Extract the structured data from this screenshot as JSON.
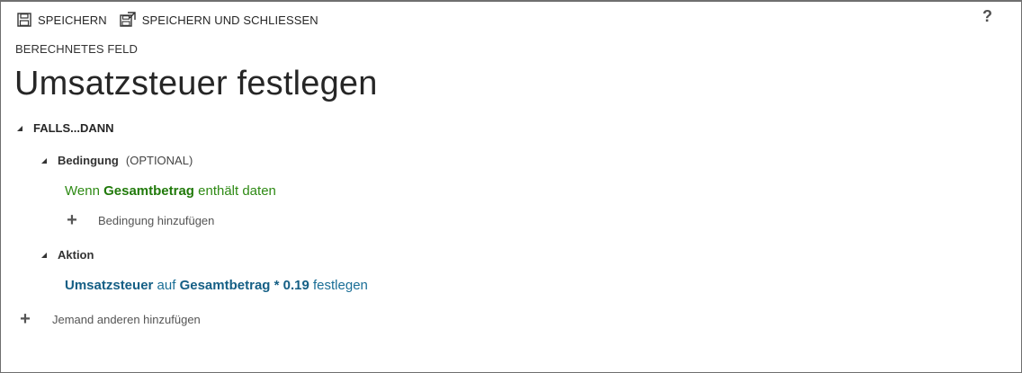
{
  "toolbar": {
    "save_label": "SPEICHERN",
    "save_close_label": "SPEICHERN UND SCHLIESSEN",
    "help_label": "?"
  },
  "header": {
    "eyebrow": "BERECHNETES FELD",
    "title": "Umsatzsteuer festlegen"
  },
  "rule": {
    "section_label": "FALLS...DANN",
    "condition": {
      "label": "Bedingung",
      "optional_label": "(OPTIONAL)",
      "prefix": "Wenn",
      "field": "Gesamtbetrag",
      "operator": "enthält daten",
      "add_label": "Bedingung hinzufügen"
    },
    "action": {
      "label": "Aktion",
      "target": "Umsatzsteuer",
      "connector": "auf",
      "expression": "Gesamtbetrag * 0.19",
      "verb": "festlegen"
    }
  },
  "footer": {
    "add_label": "Jemand anderen hinzufügen"
  },
  "colors": {
    "condition_green": "#2e8a14",
    "action_blue": "#1a6e96",
    "text_dark": "#262626"
  },
  "icons": {
    "save": "save-icon",
    "save_close": "save-close-icon",
    "help": "help-icon",
    "collapse": "collapse-triangle-icon",
    "add": "plus-icon"
  }
}
